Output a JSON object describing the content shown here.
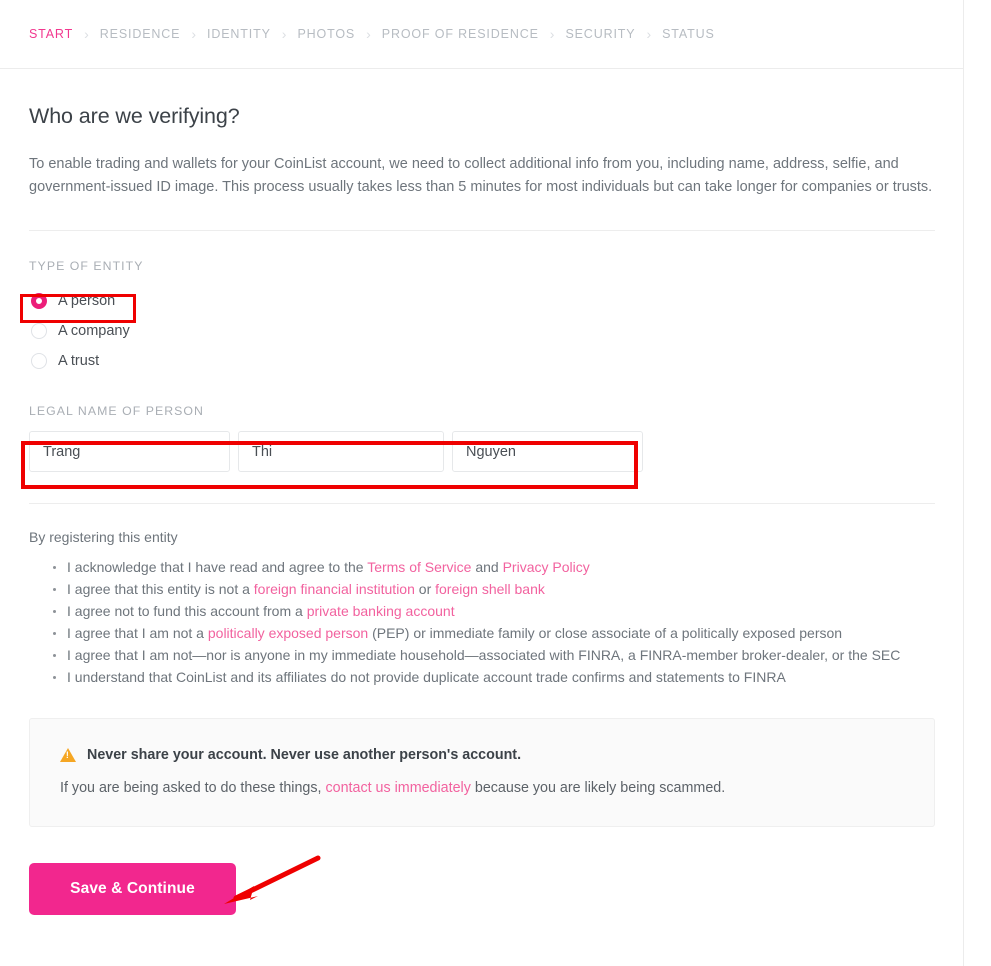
{
  "breadcrumb": {
    "separator": "›",
    "items": [
      {
        "label": "START",
        "active": true
      },
      {
        "label": "RESIDENCE",
        "active": false
      },
      {
        "label": "IDENTITY",
        "active": false
      },
      {
        "label": "PHOTOS",
        "active": false
      },
      {
        "label": "PROOF OF RESIDENCE",
        "active": false
      },
      {
        "label": "SECURITY",
        "active": false
      },
      {
        "label": "STATUS",
        "active": false
      }
    ]
  },
  "main": {
    "title": "Who are we verifying?",
    "intro": "To enable trading and wallets for your CoinList account, we need to collect additional info from you, including name, address, selfie, and government-issued ID image. This process usually takes less than 5 minutes for most individuals but can take longer for companies or trusts.",
    "entity_label": "TYPE OF ENTITY",
    "entity_options": [
      {
        "label": "A person",
        "selected": true
      },
      {
        "label": "A company",
        "selected": false
      },
      {
        "label": "A trust",
        "selected": false
      }
    ],
    "name_label": "LEGAL NAME OF PERSON",
    "name_fields": [
      {
        "name": "first-name",
        "value": "Trang",
        "placeholder": "First name"
      },
      {
        "name": "middle-name",
        "value": "Thi",
        "placeholder": "Middle name"
      },
      {
        "name": "last-name",
        "value": "Nguyen",
        "placeholder": "Last name"
      }
    ],
    "agree_intro": "By registering this entity",
    "agreements": [
      {
        "parts": [
          {
            "t": "I acknowledge that I have read and agree to the ",
            "link": false
          },
          {
            "t": "Terms of Service",
            "link": true
          },
          {
            "t": " and ",
            "link": false
          },
          {
            "t": "Privacy Policy",
            "link": true
          }
        ]
      },
      {
        "parts": [
          {
            "t": "I agree that this entity is not a ",
            "link": false
          },
          {
            "t": "foreign financial institution",
            "link": true
          },
          {
            "t": " or ",
            "link": false
          },
          {
            "t": "foreign shell bank",
            "link": true
          }
        ]
      },
      {
        "parts": [
          {
            "t": "I agree not to fund this account from a ",
            "link": false
          },
          {
            "t": "private banking account",
            "link": true
          }
        ]
      },
      {
        "parts": [
          {
            "t": "I agree that I am not a ",
            "link": false
          },
          {
            "t": "politically exposed person",
            "link": true
          },
          {
            "t": " (PEP) or immediate family or close associate of a politically exposed person",
            "link": false
          }
        ]
      },
      {
        "parts": [
          {
            "t": "I agree that I am not—nor is anyone in my immediate household—associated with FINRA, a FINRA-member broker-dealer, or the SEC",
            "link": false
          }
        ]
      },
      {
        "parts": [
          {
            "t": "I understand that CoinList and its affiliates do not provide duplicate account trade confirms and statements to FINRA",
            "link": false
          }
        ]
      }
    ],
    "warning": {
      "icon": "warning-triangle-icon",
      "headline": "Never share your account. Never use another person's account.",
      "body_parts": [
        {
          "t": "If you are being asked to do these things, ",
          "link": false
        },
        {
          "t": "contact us immediately",
          "link": true
        },
        {
          "t": " because you are likely being scammed.",
          "link": false
        }
      ]
    },
    "submit_label": "Save & Continue"
  },
  "annotations": {
    "color": "#ef0000",
    "person_box": true,
    "names_box": true,
    "arrow_to_submit": true
  },
  "colors": {
    "accent_pink": "#f2278e",
    "link_pink": "#f2629f",
    "warning_orange": "#f5a623",
    "annotation_red": "#ef0000",
    "text": "#4a4f55",
    "muted": "#a9aeb4"
  }
}
